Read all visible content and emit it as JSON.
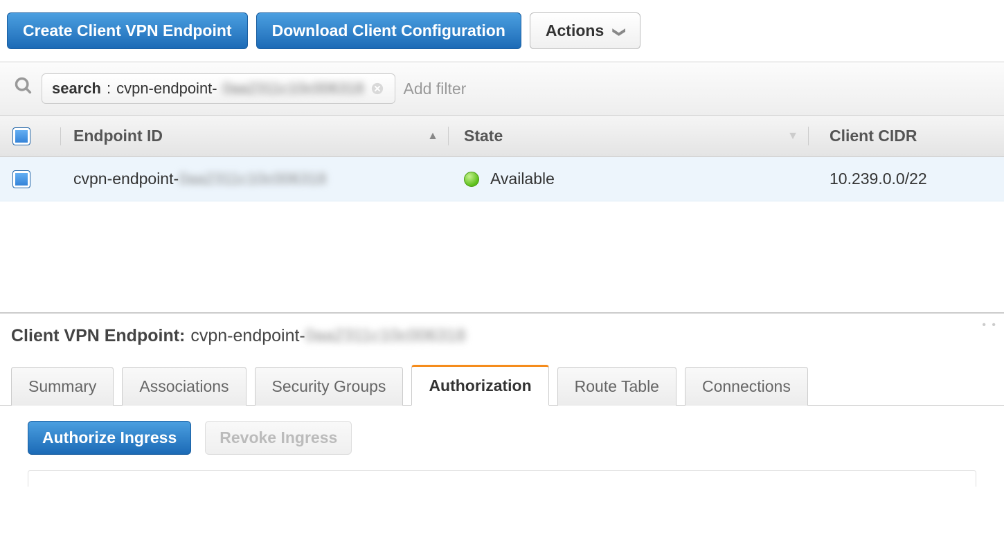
{
  "toolbar": {
    "create_label": "Create Client VPN Endpoint",
    "download_label": "Download Client Configuration",
    "actions_label": "Actions"
  },
  "filter": {
    "chip_key": "search",
    "chip_prefix": "cvpn-endpoint-",
    "chip_obscured": "0aa2311c10c006318",
    "add_filter_label": "Add filter"
  },
  "columns": {
    "endpoint": "Endpoint ID",
    "state": "State",
    "cidr": "Client CIDR"
  },
  "rows": [
    {
      "endpoint_prefix": "cvpn-endpoint-",
      "endpoint_obscured": "0aa2311c10c006318",
      "state": "Available",
      "cidr": "10.239.0.0/22",
      "selected": true
    }
  ],
  "detail": {
    "label": "Client VPN Endpoint:",
    "value_prefix": "cvpn-endpoint-",
    "value_obscured": "0aa2311c10c006318"
  },
  "tabs": [
    "Summary",
    "Associations",
    "Security Groups",
    "Authorization",
    "Route Table",
    "Connections"
  ],
  "active_tab": "Authorization",
  "tab_actions": {
    "authorize_label": "Authorize Ingress",
    "revoke_label": "Revoke Ingress"
  }
}
